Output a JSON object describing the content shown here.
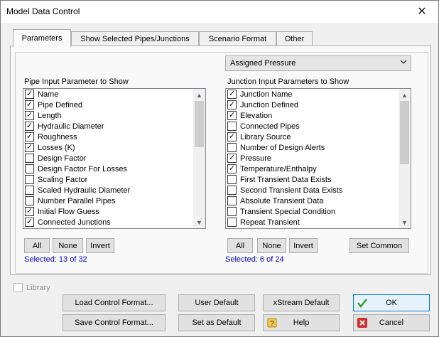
{
  "window": {
    "title": "Model Data Control",
    "close_glyph": "✕"
  },
  "tabs": [
    {
      "label": "Parameters",
      "active": true
    },
    {
      "label": "Show Selected Pipes/Junctions",
      "active": false
    },
    {
      "label": "Scenario Format",
      "active": false
    },
    {
      "label": "Other",
      "active": false
    }
  ],
  "combo": {
    "value": "Assigned Pressure"
  },
  "pipes": {
    "label": "Pipe Input Parameter to Show",
    "items": [
      {
        "label": "Name",
        "checked": true
      },
      {
        "label": "Pipe Defined",
        "checked": true
      },
      {
        "label": "Length",
        "checked": true
      },
      {
        "label": "Hydraulic Diameter",
        "checked": true
      },
      {
        "label": "Roughness",
        "checked": true
      },
      {
        "label": "Losses (K)",
        "checked": true
      },
      {
        "label": "Design Factor",
        "checked": false
      },
      {
        "label": "Design Factor For Losses",
        "checked": false
      },
      {
        "label": "Scaling Factor",
        "checked": false
      },
      {
        "label": "Scaled Hydraulic Diameter",
        "checked": false
      },
      {
        "label": "Number Parallel Pipes",
        "checked": false
      },
      {
        "label": "Initial Flow Guess",
        "checked": true
      },
      {
        "label": "Connected Junctions",
        "checked": true
      }
    ],
    "scroll_thumb_fraction": 0.4,
    "buttons": {
      "all": "All",
      "none": "None",
      "invert": "Invert"
    },
    "selected": "Selected: 13 of 32"
  },
  "junctions": {
    "label": "Junction Input Parameters to Show",
    "items": [
      {
        "label": "Junction Name",
        "checked": true
      },
      {
        "label": "Junction Defined",
        "checked": true
      },
      {
        "label": "Elevation",
        "checked": true
      },
      {
        "label": "Connected Pipes",
        "checked": false
      },
      {
        "label": "Library Source",
        "checked": true
      },
      {
        "label": "Number of Design Alerts",
        "checked": false
      },
      {
        "label": "Pressure",
        "checked": true
      },
      {
        "label": "Temperature/Enthalpy",
        "checked": true
      },
      {
        "label": "First Transient Data Exists",
        "checked": false
      },
      {
        "label": "Second Transient Data Exists",
        "checked": false
      },
      {
        "label": "Absolute Transient Data",
        "checked": false
      },
      {
        "label": "Transient Special Condition",
        "checked": false
      },
      {
        "label": "Repeat Transient",
        "checked": false
      }
    ],
    "scroll_thumb_fraction": 0.55,
    "buttons": {
      "all": "All",
      "none": "None",
      "invert": "Invert",
      "set_common": "Set Common"
    },
    "selected": "Selected: 6 of 24"
  },
  "library": {
    "label": "Library",
    "checked": false,
    "enabled": false
  },
  "bottom_buttons": {
    "load": "Load Control Format...",
    "save": "Save Control Format...",
    "user_default": "User Default",
    "set_default": "Set as Default",
    "xstream": "xStream Default",
    "help": "Help",
    "ok": "OK",
    "cancel": "Cancel"
  },
  "colors": {
    "selected_text": "#0000cc",
    "ok_border": "#0078d7",
    "check_green": "#2e9d2e",
    "cancel_red": "#d32f2f"
  },
  "icons": {
    "ok": "checkmark-icon",
    "help": "help-book-icon",
    "cancel": "cancel-x-icon"
  }
}
